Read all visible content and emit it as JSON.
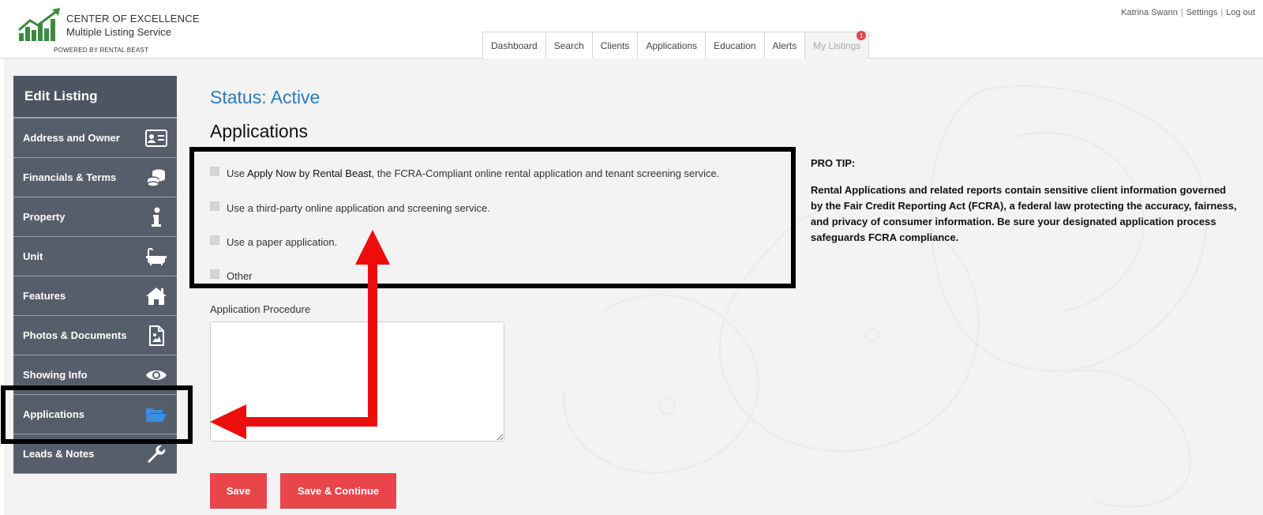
{
  "brand": {
    "line1": "CENTER OF  EXCELLENCE",
    "line2": "Multiple Listing  Service",
    "line3": "POWERED BY RENTAL BEAST"
  },
  "user_links": {
    "user": "Katrina Swann",
    "settings": "Settings",
    "logout": "Log out"
  },
  "tabs": [
    {
      "label": "Dashboard"
    },
    {
      "label": "Search"
    },
    {
      "label": "Clients"
    },
    {
      "label": "Applications"
    },
    {
      "label": "Education"
    },
    {
      "label": "Alerts"
    },
    {
      "label": "My Listings",
      "badge": "1"
    }
  ],
  "sidebar": {
    "title": "Edit Listing",
    "items": [
      {
        "label": "Address and Owner",
        "icon": "id-card-icon"
      },
      {
        "label": "Financials & Terms",
        "icon": "coins-icon"
      },
      {
        "label": "Property",
        "icon": "info-icon"
      },
      {
        "label": "Unit",
        "icon": "bathtub-icon"
      },
      {
        "label": "Features",
        "icon": "home-icon"
      },
      {
        "label": "Photos & Documents",
        "icon": "image-file-icon"
      },
      {
        "label": "Showing Info",
        "icon": "eye-icon"
      },
      {
        "label": "Applications",
        "icon": "folder-open-icon"
      },
      {
        "label": "Leads & Notes",
        "icon": "wrench-icon"
      }
    ]
  },
  "content": {
    "status": "Status: Active",
    "section_title": "Applications",
    "options": {
      "opt1_prefix": "Use ",
      "opt1_brand": "Apply Now by Rental Beast",
      "opt1_suffix": ", the FCRA-Compliant online rental application and tenant screening service.",
      "opt2": "Use a third-party online application and screening service.",
      "opt3": "Use a paper application.",
      "opt4": "Other"
    },
    "procedure_label": "Application Procedure",
    "procedure_value": "",
    "save_label": "Save",
    "save_continue_label": "Save & Continue"
  },
  "protip": {
    "title": "PRO TIP:",
    "text": "Rental Applications and related reports contain sensitive client information governed by the Fair Credit Reporting Act (FCRA), a federal law protecting the accuracy, fairness, and privacy of consumer information. Be sure your designated application process safeguards FCRA compliance."
  },
  "colors": {
    "accent_blue": "#2b7bbd",
    "button_red": "#e8464a",
    "sidebar_bg": "#575e6b",
    "folder_icon_blue": "#3a8fe0",
    "brand_green": "#3b8a3e"
  }
}
